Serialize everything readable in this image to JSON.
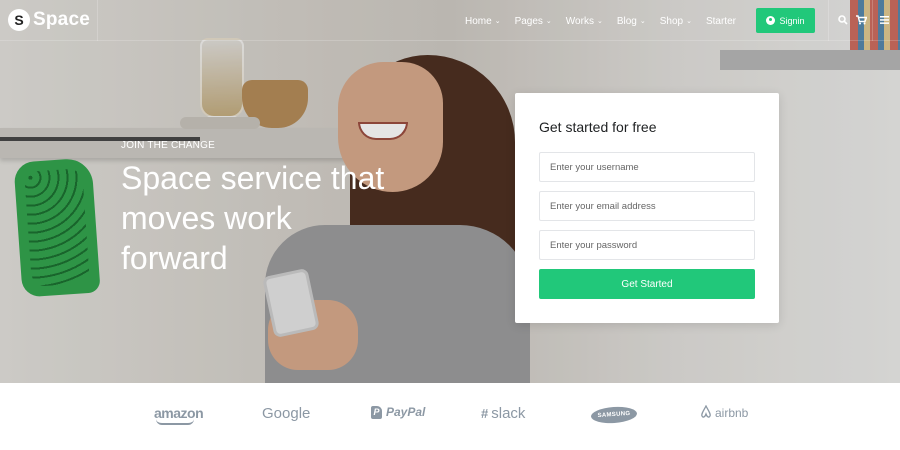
{
  "brand": {
    "mark": "S",
    "name": "Space"
  },
  "nav": {
    "items": [
      {
        "label": "Home",
        "dropdown": true
      },
      {
        "label": "Pages",
        "dropdown": true
      },
      {
        "label": "Works",
        "dropdown": true
      },
      {
        "label": "Blog",
        "dropdown": true
      },
      {
        "label": "Shop",
        "dropdown": true
      },
      {
        "label": "Starter",
        "dropdown": false
      }
    ],
    "chevron": "⌄",
    "signin_label": "Signin",
    "icons": [
      "search-icon",
      "cart-icon",
      "menu-icon"
    ]
  },
  "hero": {
    "eyebrow": "JOIN THE CHANGE",
    "headline": "Space service that moves work forward"
  },
  "form": {
    "title": "Get started for free",
    "username_placeholder": "Enter your username",
    "email_placeholder": "Enter your email address",
    "password_placeholder": "Enter your password",
    "submit_label": "Get Started"
  },
  "logos": {
    "amazon": "amazon",
    "google": "Google",
    "paypal": "PayPal",
    "slack": "slack",
    "samsung": "SAMSUNG",
    "airbnb": "airbnb"
  },
  "colors": {
    "accent": "#21c87a",
    "logo_gray": "#8c98a4"
  }
}
